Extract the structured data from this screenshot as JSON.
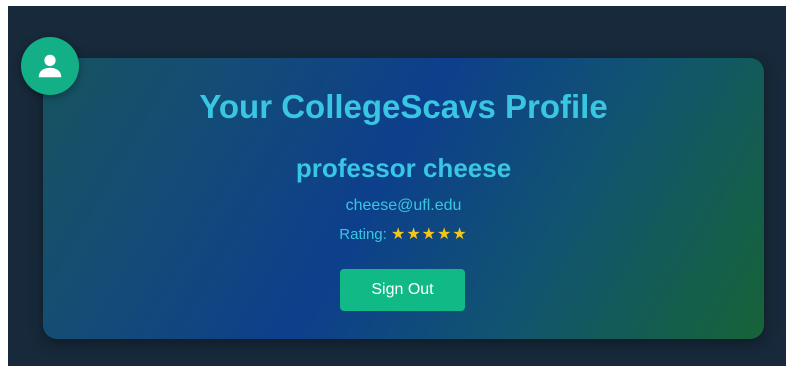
{
  "profile": {
    "title": "Your CollegeScavs Profile",
    "username": "professor cheese",
    "email": "cheese@ufl.edu",
    "rating_label": "Rating:",
    "rating_stars": "★★★★★",
    "rating_value": 5,
    "rating_max": 5,
    "sign_out_label": "Sign Out",
    "avatar_icon": "user-icon"
  },
  "colors": {
    "page_background": "#17293a",
    "accent_text": "#39c6e3",
    "button": "#10b985",
    "avatar": "#13b087",
    "star": "#f5c518"
  }
}
